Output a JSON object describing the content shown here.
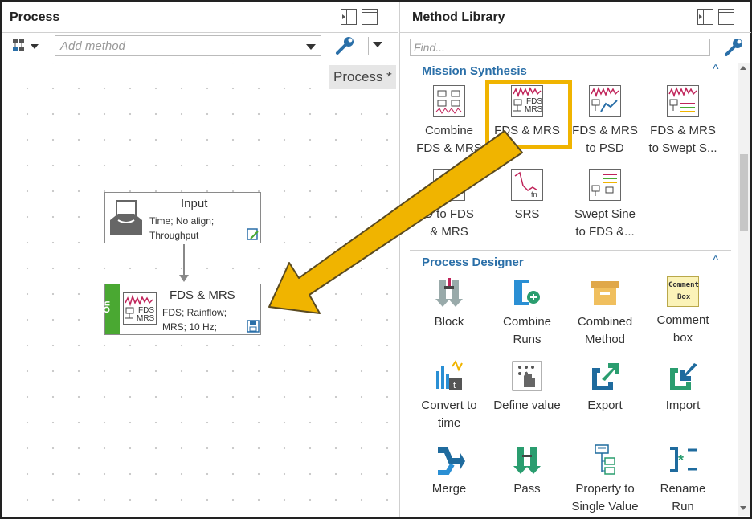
{
  "process_pane": {
    "title": "Process",
    "add_method_placeholder": "Add method",
    "process_tab": "Process *"
  },
  "nodes": {
    "input": {
      "title": "Input",
      "line1": "Time; No align;",
      "line2": "Throughput"
    },
    "fds": {
      "title": "FDS & MRS",
      "line1": "FDS; Rainflow;",
      "line2": "MRS; 10 Hz;",
      "on_label": "On"
    }
  },
  "library": {
    "title": "Method Library",
    "find_placeholder": "Find...",
    "sections": [
      {
        "title": "Mission Synthesis",
        "items": [
          {
            "line1": "Combine",
            "line2": "FDS & MRS"
          },
          {
            "line1": "FDS & MRS",
            "line2": ""
          },
          {
            "line1": "FDS & MRS",
            "line2": "to PSD"
          },
          {
            "line1": "FDS & MRS",
            "line2": "to Swept S..."
          },
          {
            "line1": "D to FDS",
            "line2": "& MRS"
          },
          {
            "line1": "SRS",
            "line2": ""
          },
          {
            "line1": "Swept Sine",
            "line2": "to FDS &..."
          }
        ]
      },
      {
        "title": "Process Designer",
        "items": [
          {
            "line1": "Block",
            "line2": ""
          },
          {
            "line1": "Combine",
            "line2": "Runs"
          },
          {
            "line1": "Combined",
            "line2": "Method"
          },
          {
            "line1": "Comment",
            "line2": "box"
          },
          {
            "line1": "Convert to",
            "line2": "time"
          },
          {
            "line1": "Define value",
            "line2": ""
          },
          {
            "line1": "Export",
            "line2": ""
          },
          {
            "line1": "Import",
            "line2": ""
          },
          {
            "line1": "Merge",
            "line2": ""
          },
          {
            "line1": "Pass",
            "line2": ""
          },
          {
            "line1": "Property to",
            "line2": "Single Value"
          },
          {
            "line1": "Rename",
            "line2": "Run"
          }
        ]
      }
    ]
  },
  "icon_text": {
    "fds": "FDS",
    "mrs": "MRS",
    "comment": "Comment",
    "box": "Box"
  },
  "colors": {
    "accent": "#2a6fa8",
    "highlight": "#f0b400",
    "on_green": "#4aa832"
  }
}
